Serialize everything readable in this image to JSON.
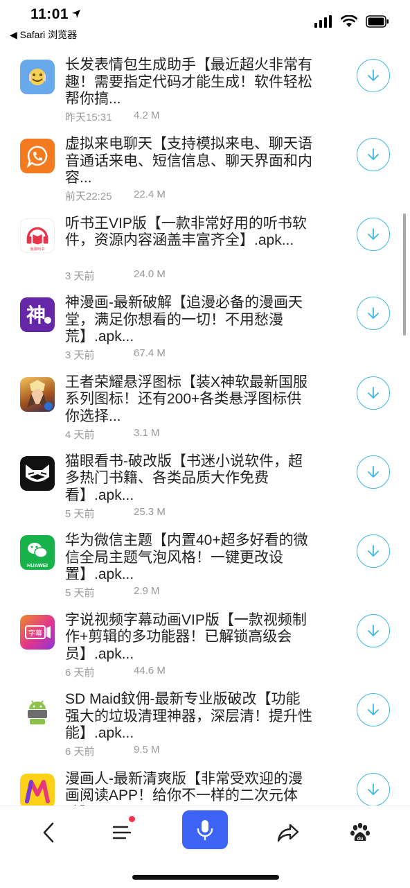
{
  "status_bar": {
    "time": "11:01",
    "back_app": "◀ Safari 浏览器"
  },
  "items": [
    {
      "title": "长发表情包生成助手【最近超火非常有趣！需要指定代码才能生成！软件轻松帮你搞...",
      "date": "昨天15:31",
      "size": "4.2 M"
    },
    {
      "title": "虚拟来电聊天【支持模拟来电、聊天语音通话来电、短信信息、聊天界面和内容...",
      "date": "前天22:25",
      "size": "22.4 M"
    },
    {
      "title": "听书王VIP版【一款非常好用的听书软件，资源内容涵盖丰富齐全】.apk...",
      "date": "3 天前",
      "size": "24.0 M"
    },
    {
      "title": "神漫画-最新破解【追漫必备的漫画天堂，满足你想看的一切！不用愁漫荒】.apk...",
      "date": "3 天前",
      "size": "67.4 M"
    },
    {
      "title": "王者荣耀悬浮图标【装X神软最新国服系列图标！还有200+各类悬浮图标供你选择...",
      "date": "4 天前",
      "size": "3.1 M"
    },
    {
      "title": "猫眼看书-破改版【书迷小说软件，超多热门书籍、各类品质大作免费看】.apk...",
      "date": "5 天前",
      "size": "25.3 M"
    },
    {
      "title": "华为微信主题【内置40+超多好看的微信全局主题气泡风格！一键更改设置】.apk...",
      "date": "5 天前",
      "size": "2.9 M"
    },
    {
      "title": "字说视频字幕动画VIP版【一款视频制作+剪辑的多功能器！已解锁高级会员】.apk...",
      "date": "6 天前",
      "size": "44.6 M"
    },
    {
      "title": "SD Maid鈫佣-最新专业版破改【功能强大的垃圾清理神器，深层清！提升性能】.apk...",
      "date": "6 天前",
      "size": "9.5 M"
    },
    {
      "title": "漫画人-最新清爽版【非常受欢迎的漫画阅读APP！给你不一样的二次元体验】.apk...",
      "date": "",
      "size": ""
    }
  ],
  "icon_text": {
    "listen_badge": "免费听书",
    "shen": "神",
    "huawei": "HUAWEI",
    "zimu": "字幕"
  },
  "colors": {
    "accent": "#3db7e4",
    "voice": "#3d64f5",
    "badge": "#f2334c"
  }
}
